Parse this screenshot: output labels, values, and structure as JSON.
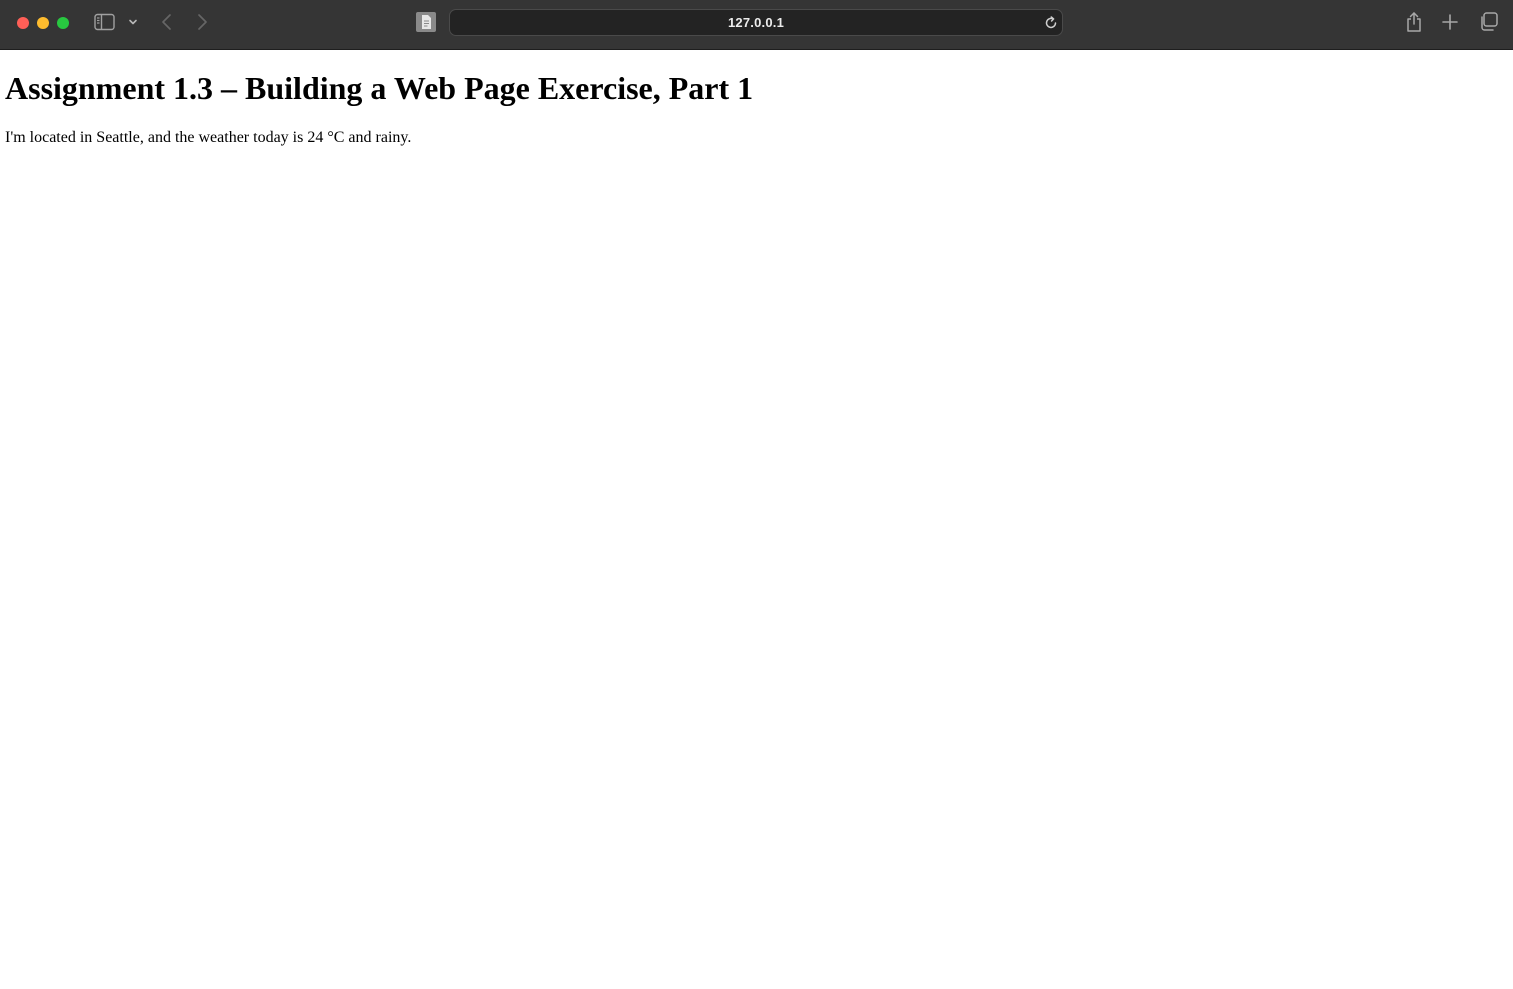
{
  "browser": {
    "url": "127.0.0.1",
    "icons": [
      "close-icon",
      "minimize-icon",
      "zoom-icon",
      "sidebar-icon",
      "chevron-down-icon",
      "back-icon",
      "forward-icon",
      "page-icon",
      "reload-icon",
      "share-icon",
      "new-tab-icon",
      "tab-overview-icon"
    ],
    "colors": {
      "toolbar": "#353535",
      "address_bar": "#232323"
    }
  },
  "page": {
    "heading": "Assignment 1.3 – Building a Web Page Exercise, Part 1",
    "paragraph": "I'm located in Seattle, and the weather today is 24 °C and rainy."
  }
}
